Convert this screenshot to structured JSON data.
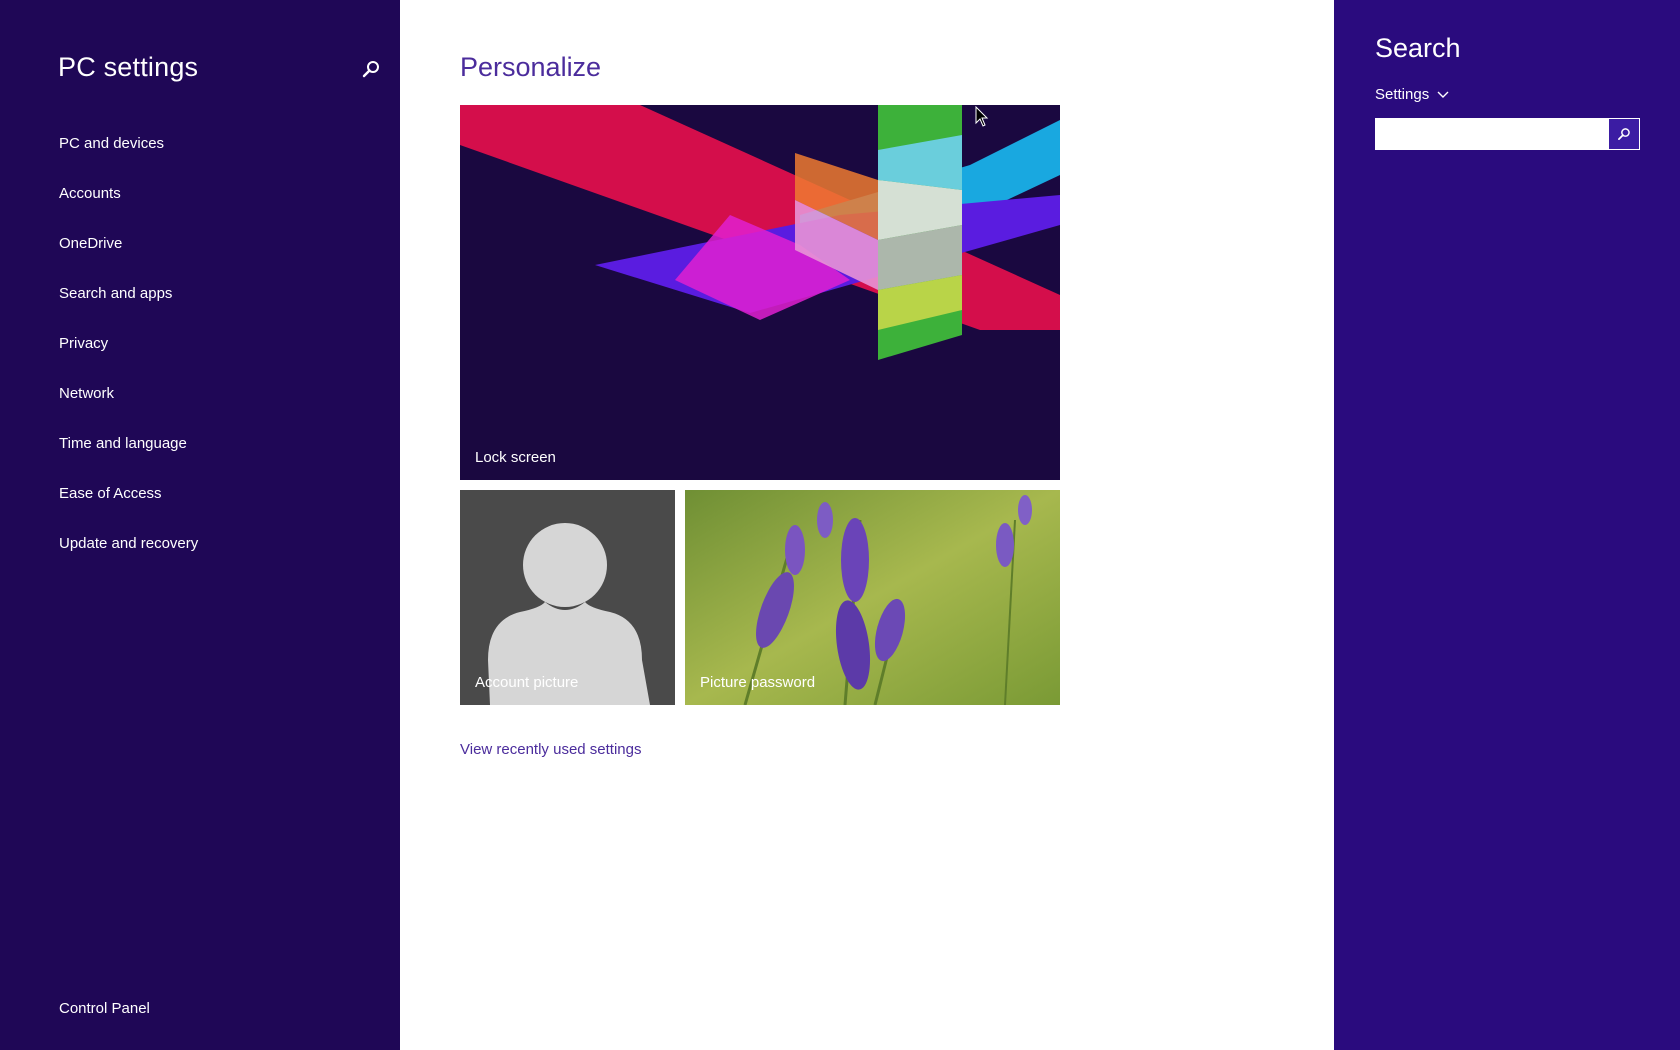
{
  "colors": {
    "nav_bg": "#1f0756",
    "charm_bg": "#2a0b7e",
    "accent_text": "#4b2c9c",
    "search_button": "#3b1ca3"
  },
  "nav": {
    "title": "PC settings",
    "search_icon": "search-icon",
    "items": [
      {
        "label": "PC and devices"
      },
      {
        "label": "Accounts"
      },
      {
        "label": "OneDrive"
      },
      {
        "label": "Search and apps"
      },
      {
        "label": "Privacy"
      },
      {
        "label": "Network"
      },
      {
        "label": "Time and language"
      },
      {
        "label": "Ease of Access"
      },
      {
        "label": "Update and recovery"
      }
    ],
    "footer": "Control Panel"
  },
  "main": {
    "title": "Personalize",
    "tiles": {
      "lock_screen": "Lock screen",
      "account_picture": "Account picture",
      "picture_password": "Picture password"
    },
    "recent_link": "View recently used settings"
  },
  "charm": {
    "title": "Search",
    "scope": "Settings",
    "scope_icon": "chevron-down-icon",
    "search_value": "",
    "search_button_icon": "search-icon"
  }
}
